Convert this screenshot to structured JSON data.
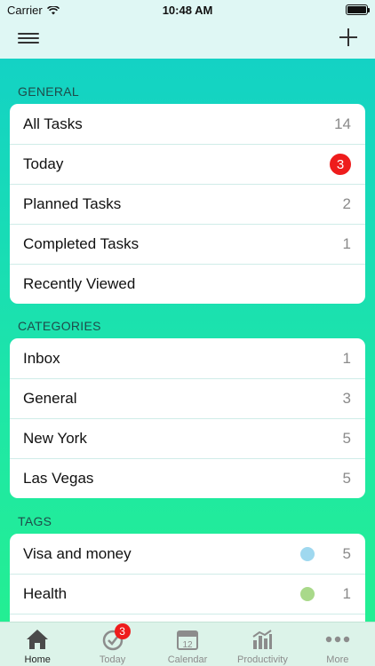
{
  "status_bar": {
    "carrier": "Carrier",
    "time": "10:48 AM"
  },
  "navbar": {
    "menu_icon": "hamburger-menu-icon",
    "add_icon": "plus-icon"
  },
  "sections": {
    "general": {
      "title": "GENERAL",
      "items": [
        {
          "label": "All Tasks",
          "count": "14"
        },
        {
          "label": "Today",
          "badge": "3"
        },
        {
          "label": "Planned Tasks",
          "count": "2"
        },
        {
          "label": "Completed Tasks",
          "count": "1"
        },
        {
          "label": "Recently Viewed",
          "count": ""
        }
      ]
    },
    "categories": {
      "title": "CATEGORIES",
      "items": [
        {
          "label": "Inbox",
          "count": "1"
        },
        {
          "label": "General",
          "count": "3"
        },
        {
          "label": "New York",
          "count": "5"
        },
        {
          "label": "Las Vegas",
          "count": "5"
        }
      ]
    },
    "tags": {
      "title": "TAGS",
      "items": [
        {
          "label": "Visa and money",
          "count": "5",
          "color": "#9fd8ef"
        },
        {
          "label": "Health",
          "count": "1",
          "color": "#a9d98a"
        }
      ]
    }
  },
  "tabbar": {
    "tabs": [
      {
        "label": "Home",
        "icon": "home-icon",
        "active": true
      },
      {
        "label": "Today",
        "icon": "today-check-icon",
        "badge": "3"
      },
      {
        "label": "Calendar",
        "icon": "calendar-icon",
        "day": "12"
      },
      {
        "label": "Productivity",
        "icon": "productivity-chart-icon"
      },
      {
        "label": "More",
        "icon": "more-dots-icon"
      }
    ]
  },
  "colors": {
    "accent_badge": "#ee1c1c",
    "header_bg": "#dff7f4",
    "gradient_top": "#12cfc9",
    "gradient_bottom": "#24f08f"
  }
}
